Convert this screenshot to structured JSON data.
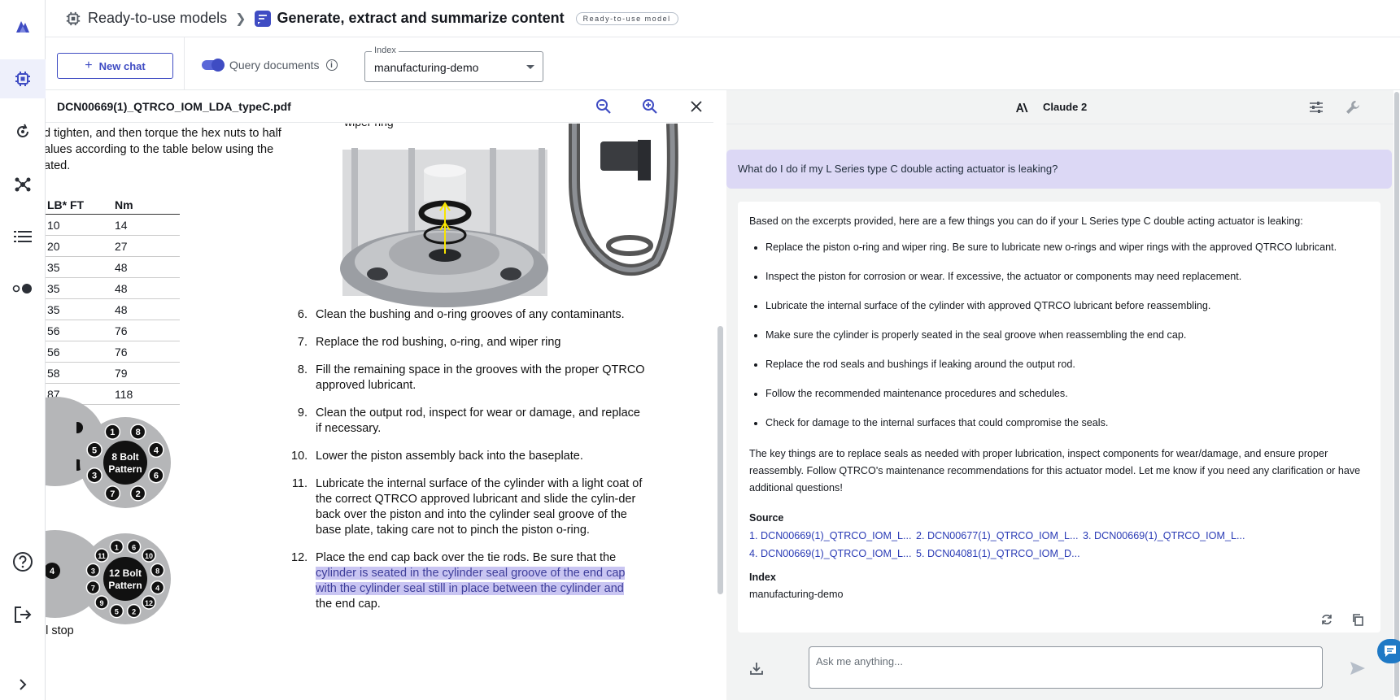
{
  "header": {
    "breadcrumb_root": "Ready-to-use models",
    "breadcrumb_current": "Generate, extract and summarize content",
    "badge": "Ready-to-use model"
  },
  "toolbar": {
    "new_chat_label": "New chat",
    "query_documents_label": "Query documents",
    "query_documents_enabled": true,
    "index_label": "Index",
    "index_value": "manufacturing-demo"
  },
  "pdf": {
    "filename": "DCN00669(1)_QTRCO_IOM_LDA_typeC.pdf",
    "left_text": [
      "d tighten, and then torque the hex nuts to half",
      "alues according to the table below using the",
      "ated."
    ],
    "cut_text": "wiper ring",
    "torque_headers": [
      "LB* FT",
      "Nm"
    ],
    "torque_rows": [
      [
        "10",
        "14"
      ],
      [
        "20",
        "27"
      ],
      [
        "35",
        "48"
      ],
      [
        "35",
        "48"
      ],
      [
        "35",
        "48"
      ],
      [
        "56",
        "76"
      ],
      [
        "56",
        "76"
      ],
      [
        "58",
        "79"
      ],
      [
        "87",
        "118"
      ]
    ],
    "bolt_8_label": [
      "8 Bolt",
      "Pattern"
    ],
    "bolt_12_label": [
      "12 Bolt",
      "Pattern"
    ],
    "bolt_8_numbers": [
      "1",
      "8",
      "4",
      "6",
      "2",
      "7",
      "3",
      "5"
    ],
    "bolt_12_numbers": [
      "1",
      "6",
      "10",
      "8",
      "4",
      "12",
      "2",
      "5",
      "9",
      "7",
      "3",
      "11"
    ],
    "partial_bolt_number": "4",
    "bottom_left_text": "el stop",
    "steps": [
      {
        "n": "6.",
        "text": "Clean the bushing and o-ring grooves of any contaminants."
      },
      {
        "n": "7.",
        "text": "Replace the rod bushing, o-ring, and wiper ring"
      },
      {
        "n": "8.",
        "text": "Fill the remaining space in the grooves with the proper QTRCO approved lubricant."
      },
      {
        "n": "9.",
        "text": "Clean the output rod, inspect for wear or damage, and replace if necessary."
      },
      {
        "n": "10.",
        "text": "Lower the piston assembly back into the baseplate."
      },
      {
        "n": "11.",
        "text": "Lubricate the internal surface of the cylinder with a light coat of the correct QTRCO approved lubricant and slide the cylin-der back over the piston and into the cylinder seal groove of the base plate, taking care not to pinch the piston o-ring."
      }
    ],
    "step12_n": "12.",
    "step12_plain": "Place the end cap back over the tie rods.  Be sure that the",
    "step12_highlight_1": "cylinder is seated in the cylinder seal groove of the end cap",
    "step12_highlight_2": "with the cylinder seal still in place between the cylinder and",
    "step12_tail": "the end cap."
  },
  "chat": {
    "model_name": "Claude 2",
    "question": "What do I do if my L Series type C double acting actuator is leaking?",
    "answer_intro": "Based on the excerpts provided, here are a few things you can do if your L Series type C double acting actuator is leaking:",
    "answer_bullets": [
      "Replace the piston o-ring and wiper ring. Be sure to lubricate new o-rings and wiper rings with the approved QTRCO lubricant.",
      "Inspect the piston for corrosion or wear. If excessive, the actuator or components may need replacement.",
      "Lubricate the internal surface of the cylinder with approved QTRCO lubricant before reassembling.",
      "Make sure the cylinder is properly seated in the seal groove when reassembling the end cap.",
      "Replace the rod seals and bushings if leaking around the output rod.",
      "Follow the recommended maintenance procedures and schedules.",
      "Check for damage to the internal surfaces that could compromise the seals."
    ],
    "answer_summary": "The key things are to replace seals as needed with proper lubrication, inspect components for wear/damage, and ensure proper reassembly. Follow QTRCO's maintenance recommendations for this actuator model. Let me know if you need any clarification or have additional questions!",
    "source_heading": "Source",
    "sources": [
      "1. DCN00669(1)_QTRCO_IOM_L...",
      "2. DCN00677(1)_QTRCO_IOM_L...",
      "3. DCN00669(1)_QTRCO_IOM_L...",
      "4. DCN00669(1)_QTRCO_IOM_L...",
      "5. DCN04081(1)_QTRCO_IOM_D..."
    ],
    "index_heading": "Index",
    "index_value": "manufacturing-demo",
    "input_placeholder": "Ask me anything..."
  },
  "colors": {
    "accent": "#3f4cc3",
    "question_bg": "#dcd8f5",
    "highlight": "#c9c5f2",
    "link": "#2a3bb5"
  },
  "icons": {
    "rail": [
      "app-logo-icon",
      "models-chip-icon",
      "refresh-icon",
      "network-icon",
      "list-icon",
      "theme-toggle-icon",
      "help-icon",
      "sign-out-icon",
      "expand-icon"
    ]
  }
}
